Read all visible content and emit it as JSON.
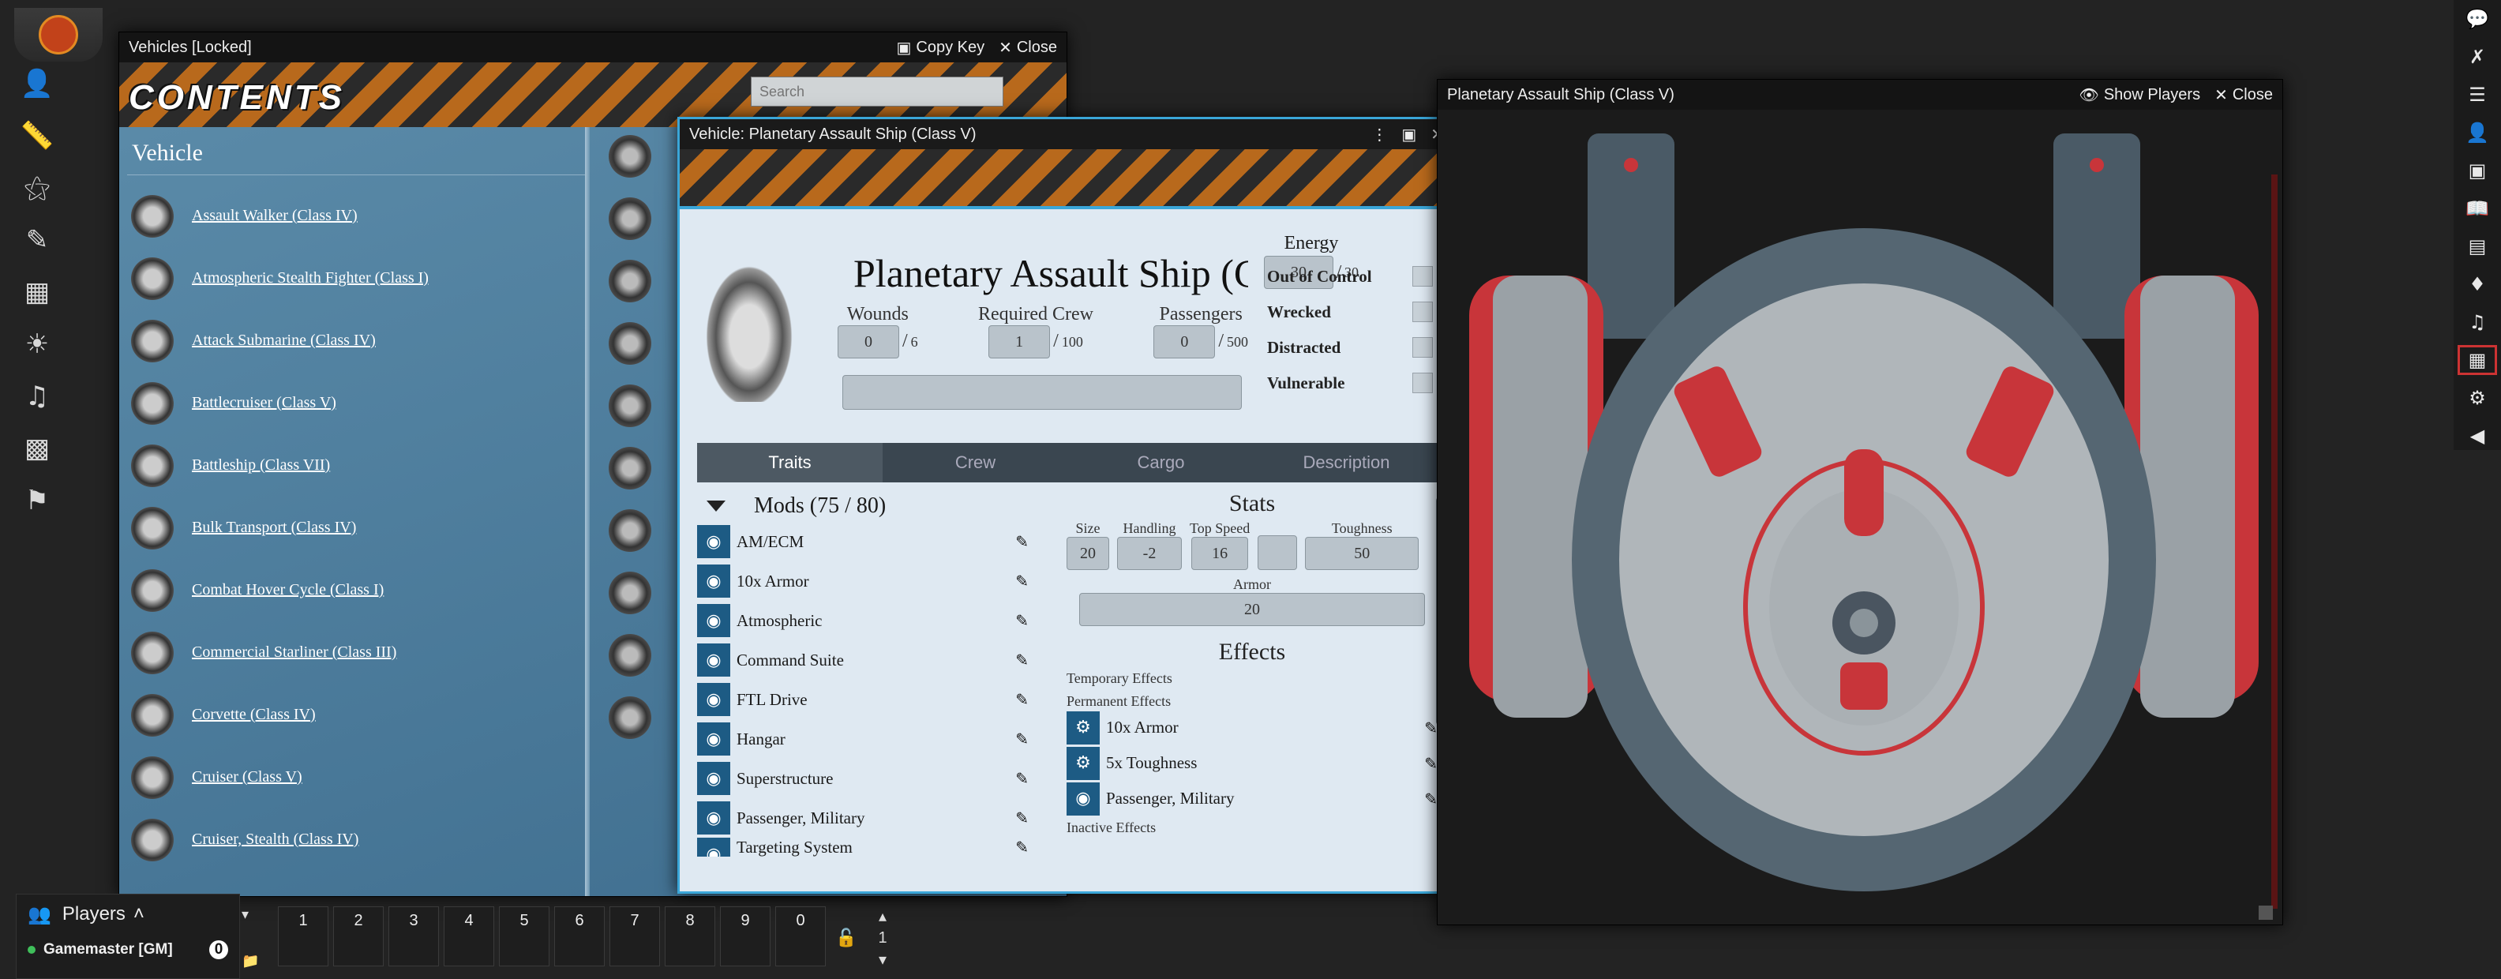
{
  "vehicles_window": {
    "title": "Vehicles [Locked]",
    "copy_key": "Copy Key",
    "close": "Close",
    "banner": "CONTENTS",
    "search_placeholder": "Search",
    "category": "Vehicle",
    "items": [
      "Assault Walker (Class IV)",
      "Atmospheric Stealth Fighter (Class I)",
      "Attack Submarine (Class IV)",
      "Battlecruiser (Class V)",
      "Battleship (Class VII)",
      "Bulk Transport (Class IV)",
      "Combat Hover Cycle (Class I)",
      "Commercial Starliner (Class III)",
      "Corvette (Class IV)",
      "Cruiser (Class V)",
      "Cruiser, Stealth (Class IV)"
    ]
  },
  "sheet": {
    "window_title": "Vehicle: Planetary Assault Ship (Class V)",
    "name": "Planetary Assault Ship (Class V)",
    "energy_label": "Energy",
    "energy_value": "30",
    "energy_max": "30",
    "wounds_label": "Wounds",
    "wounds_value": "0",
    "wounds_max": "6",
    "crew_label": "Required Crew",
    "crew_value": "1",
    "crew_max": "100",
    "passengers_label": "Passengers",
    "passengers_value": "0",
    "passengers_max": "500",
    "slash": "/",
    "conditions": [
      "Out of Control",
      "Wrecked",
      "Distracted",
      "Vulnerable"
    ],
    "tabs": [
      "Traits",
      "Crew",
      "Cargo",
      "Description"
    ],
    "mods_title": "Mods (75 / 80)",
    "mods": [
      "AM/ECM",
      "10x Armor",
      "Atmospheric",
      "Command Suite",
      "FTL Drive",
      "Hangar",
      "Superstructure",
      "Passenger, Military",
      "Targeting System"
    ],
    "stats_title": "Stats",
    "size_label": "Size",
    "size_value": "20",
    "handling_label": "Handling",
    "handling_value": "-2",
    "topspeed_label": "Top Speed",
    "topspeed_value": "16",
    "toughness_label": "Toughness",
    "toughness_value": "50",
    "armor_label": "Armor",
    "armor_value": "20",
    "effects_title": "Effects",
    "temporary_effects": "Temporary Effects",
    "permanent_effects": "Permanent Effects",
    "effects": [
      "10x Armor",
      "5x Toughness",
      "Passenger, Military"
    ],
    "inactive_effects": "Inactive Effects"
  },
  "popout": {
    "title": "Planetary Assault Ship (Class V)",
    "show_players": "Show Players",
    "close": "Close"
  },
  "players": {
    "label": "Players",
    "gm": "Gamemaster [GM]",
    "gm_count": "0"
  },
  "hotbar": {
    "slots": [
      "1",
      "2",
      "3",
      "4",
      "5",
      "6",
      "7",
      "8",
      "9",
      "0"
    ],
    "page": "1"
  },
  "colors": {
    "accent": "#3aa6d8",
    "hazard": "#b8691c",
    "mod_icon": "#1d5b84",
    "active_tab": "#c33333"
  }
}
